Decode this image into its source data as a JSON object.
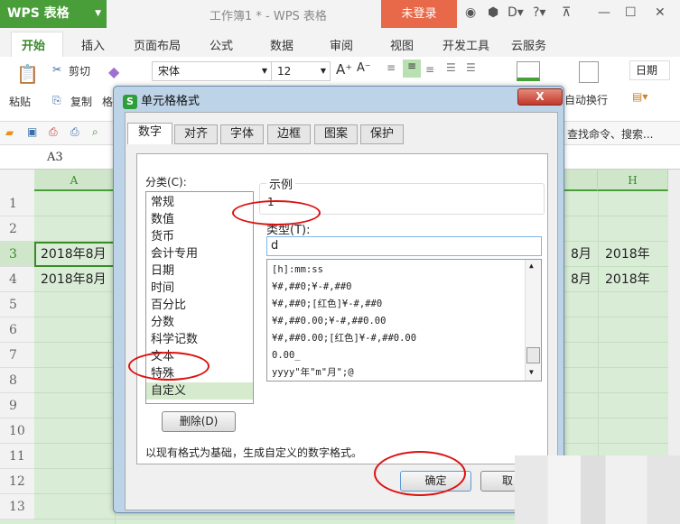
{
  "app": {
    "logo": "WPS 表格",
    "window_title": "工作簿1 * - WPS 表格",
    "login": "未登录"
  },
  "ribbon_tabs": [
    "开始",
    "插入",
    "页面布局",
    "公式",
    "数据",
    "审阅",
    "视图",
    "开发工具",
    "云服务"
  ],
  "ribbon": {
    "paste": "粘贴",
    "cut": "剪切",
    "copy": "复制",
    "format_painter": "格",
    "font": "宋体",
    "size": "12",
    "wrap": "自动换行",
    "number_format": "日期",
    "search": "查找命令、搜索..."
  },
  "formula_bar": {
    "cell_ref": "A3"
  },
  "sheet": {
    "columns": [
      "A",
      "H"
    ],
    "rows": [
      "1",
      "2",
      "3",
      "4",
      "5",
      "6",
      "7",
      "8",
      "9",
      "10",
      "11",
      "12",
      "13"
    ],
    "cells": {
      "A3": "2018年8月",
      "A4": "2018年8月",
      "G3": "8月",
      "G4": "8月",
      "H3": "2018年",
      "H4": "2018年"
    }
  },
  "dialog": {
    "title": "单元格格式",
    "close": "X",
    "tabs": [
      "数字",
      "对齐",
      "字体",
      "边框",
      "图案",
      "保护"
    ],
    "category_label": "分类(C):",
    "categories": [
      "常规",
      "数值",
      "货币",
      "会计专用",
      "日期",
      "时间",
      "百分比",
      "分数",
      "科学记数",
      "文本",
      "特殊",
      "自定义"
    ],
    "selected_category": "自定义",
    "sample_label": "示例",
    "sample_value": "1",
    "type_label": "类型(T):",
    "type_value": "d",
    "formats": [
      "[h]:mm:ss",
      "¥#,##0;¥-#,##0",
      "¥#,##0;[红色]¥-#,##0",
      "¥#,##0.00;¥-#,##0.00",
      "¥#,##0.00;[红色]¥-#,##0.00",
      "0.00_",
      "yyyy\"年\"m\"月\";@"
    ],
    "delete_button": "删除(D)",
    "description": "以现有格式为基础，生成自定义的数字格式。",
    "ok_button": "确定",
    "cancel_button": "取"
  }
}
